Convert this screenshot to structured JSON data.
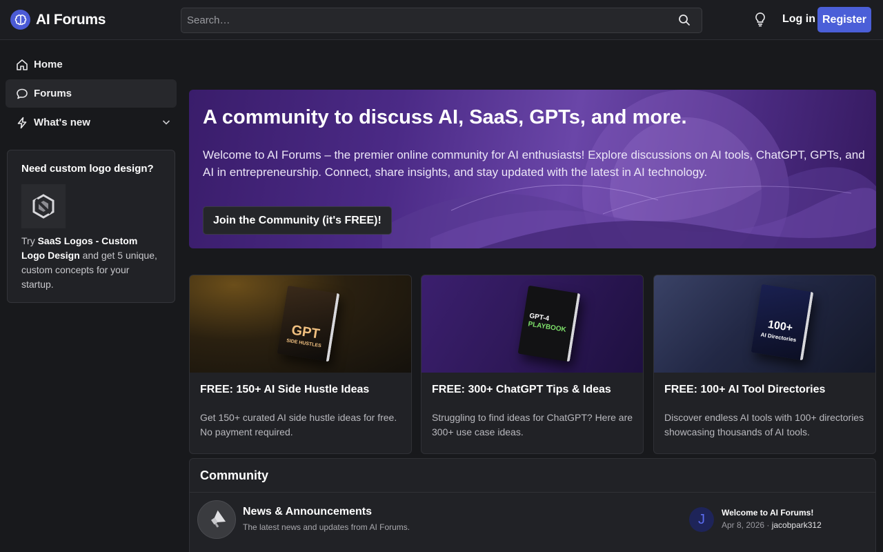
{
  "header": {
    "site_name": "AI Forums",
    "search_placeholder": "Search…",
    "login_label": "Log in",
    "register_label": "Register"
  },
  "sidebar": {
    "items": [
      {
        "label": "Home",
        "icon": "home-icon"
      },
      {
        "label": "Forums",
        "icon": "chat-bubble-icon",
        "active": true
      },
      {
        "label": "What's new",
        "icon": "lightning-icon",
        "expandable": true
      }
    ],
    "promo": {
      "title": "Need custom logo design?",
      "text_prefix": "Try ",
      "link_label": "SaaS Logos - Custom Logo Design",
      "text_suffix": " and get 5 unique, custom concepts for your startup."
    }
  },
  "hero": {
    "title": "A community to discuss AI, SaaS, GPTs, and more.",
    "text": "Welcome to AI Forums – the premier online community for AI enthusiasts! Explore discussions on AI tools, ChatGPT, GPTs, and AI in entrepreneurship. Connect, share insights, and stay updated with the latest in AI technology.",
    "button_label": "Join the Community (it's FREE)!"
  },
  "cards": [
    {
      "title": "FREE: 150+ AI Side Hustle Ideas",
      "desc": "Get 150+ curated AI side hustle ideas for free. No payment required.",
      "book_line1": "GPT",
      "book_line2": "SIDE HUSTLES"
    },
    {
      "title": "FREE: 300+ ChatGPT Tips & Ideas",
      "desc": "Struggling to find ideas for ChatGPT? Here are 300+ use case ideas.",
      "book_line1": "GPT-4",
      "book_line2": "PLAYBOOK"
    },
    {
      "title": "FREE: 100+ AI Tool Directories",
      "desc": "Discover endless AI tools with 100+ directories showcasing thousands of AI tools.",
      "book_line1": "100+",
      "book_line2": "AI Directories"
    }
  ],
  "community": {
    "heading": "Community",
    "nodes": [
      {
        "title": "News & Announcements",
        "desc": "The latest news and updates from AI Forums.",
        "latest": {
          "avatar_letter": "J",
          "title": "Welcome to AI Forums!",
          "date": "Apr 8, 2026",
          "separator": " · ",
          "user": "jacobpark312"
        }
      }
    ]
  },
  "colors": {
    "accent": "#4b5fd8",
    "background": "#18191c",
    "panel": "#212226",
    "hero": "#4b2a86"
  }
}
